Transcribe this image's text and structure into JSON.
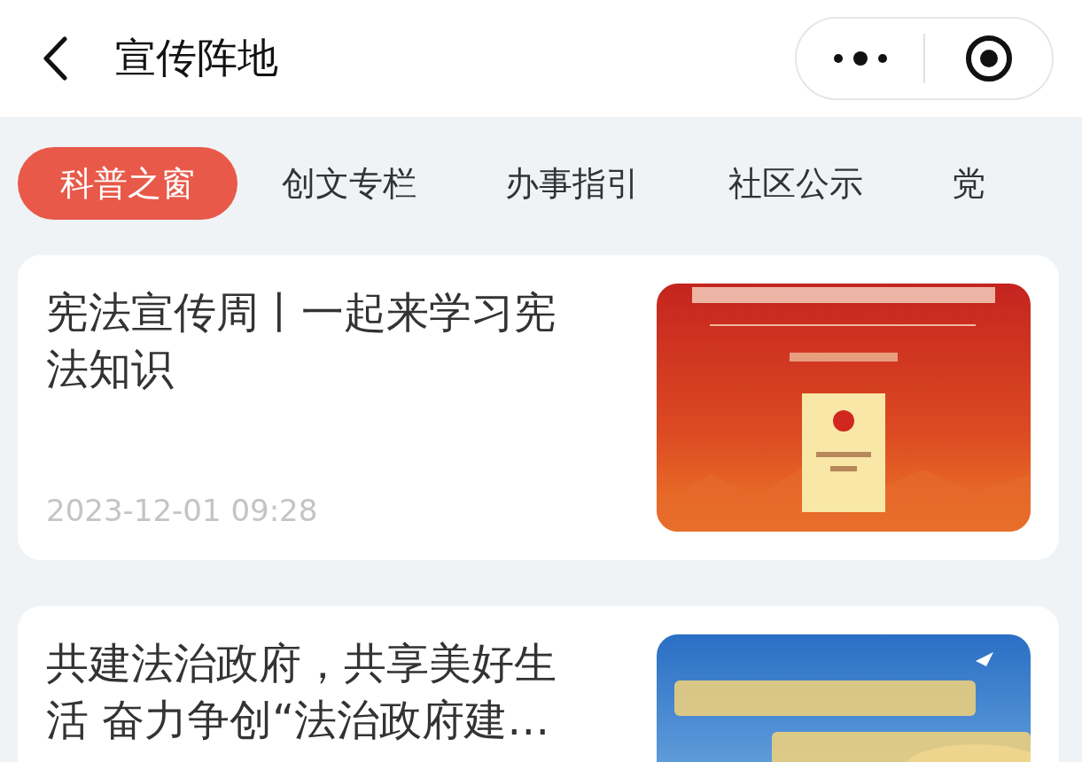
{
  "header": {
    "title": "宣传阵地"
  },
  "tabs": [
    {
      "label": "科普之窗",
      "selected": true
    },
    {
      "label": "创文专栏",
      "selected": false
    },
    {
      "label": "办事指引",
      "selected": false
    },
    {
      "label": "社区公示",
      "selected": false
    },
    {
      "label": "党",
      "selected": false
    }
  ],
  "articles": [
    {
      "title": "宪法宣传周丨一起来学习宪法知识",
      "date": "2023-12-01 09:28"
    },
    {
      "title": "共建法治政府，共享美好生活 奋力争创“法治政府建…"
    }
  ]
}
